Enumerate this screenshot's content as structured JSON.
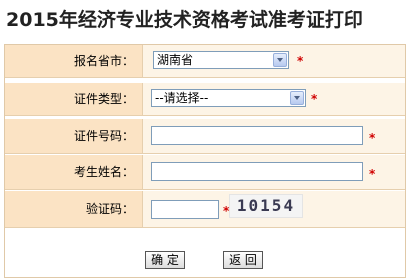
{
  "page": {
    "title": "2015年经济专业技术资格考试准考证打印"
  },
  "form": {
    "province": {
      "label": "报名省市：",
      "value": "湖南省"
    },
    "id_type": {
      "label": "证件类型：",
      "value": "--请选择--"
    },
    "id_number": {
      "label": "证件号码：",
      "value": ""
    },
    "name": {
      "label": "考生姓名：",
      "value": ""
    },
    "captcha": {
      "label": "验证码：",
      "value": "",
      "image_text": "10154"
    },
    "required_mark": "*"
  },
  "buttons": {
    "confirm": "确 定",
    "back": "返 回"
  }
}
